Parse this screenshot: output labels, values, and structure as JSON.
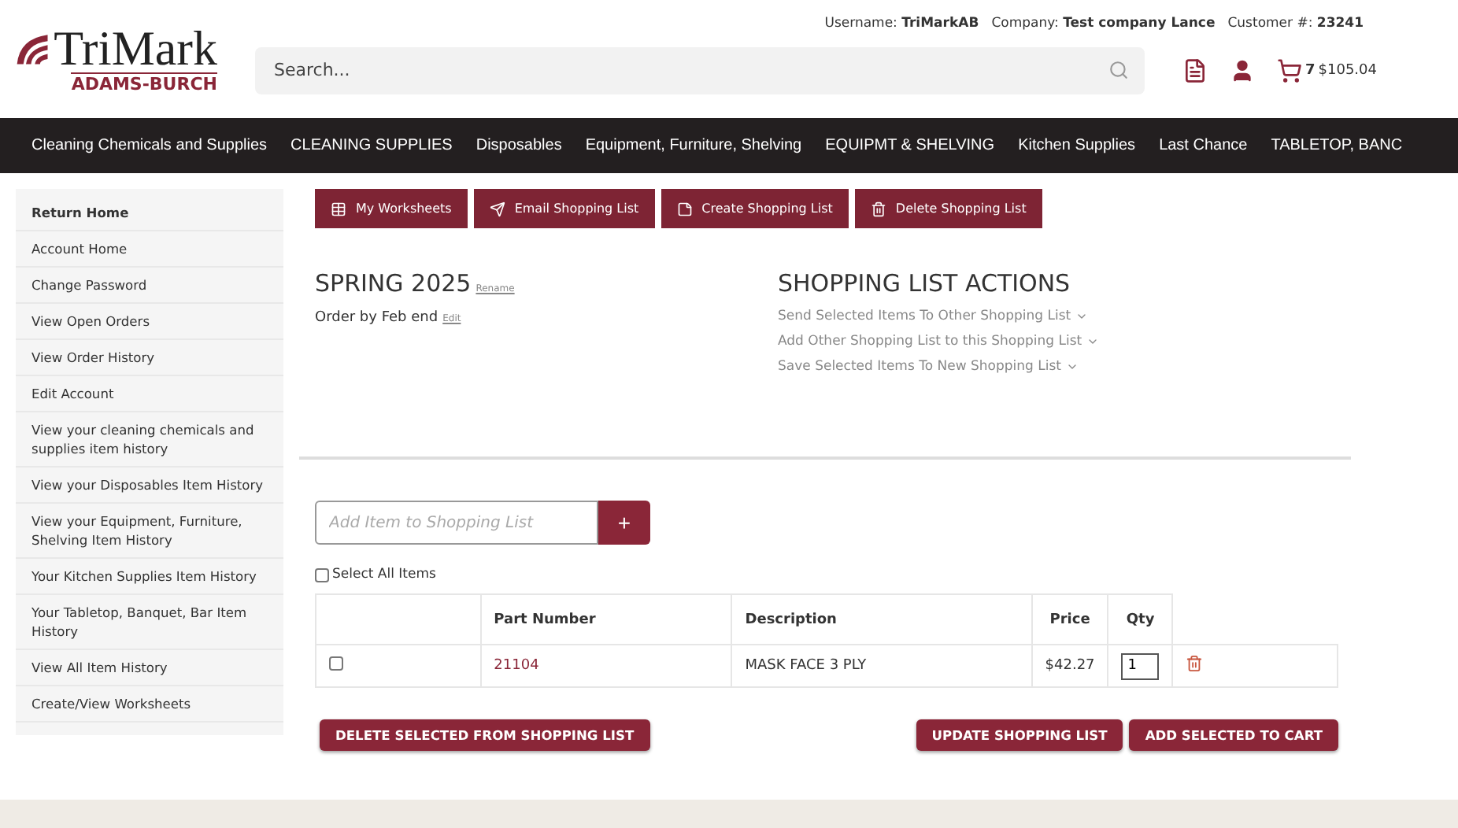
{
  "header": {
    "logo": {
      "name": "TriMark",
      "subtitle": "ADAMS-BURCH"
    },
    "search": {
      "placeholder": "Search..."
    },
    "account": [
      {
        "label": "Username:",
        "value": "TriMarkAB"
      },
      {
        "label": "Company:",
        "value": "Test company Lance"
      },
      {
        "label": "Customer #:",
        "value": "23241"
      }
    ],
    "cart": {
      "count": "7",
      "total": "$105.04"
    }
  },
  "nav": [
    "Cleaning Chemicals and Supplies",
    "CLEANING SUPPLIES",
    "Disposables",
    "Equipment, Furniture, Shelving",
    "EQUIPMT & SHELVING",
    "Kitchen Supplies",
    "Last Chance",
    "TABLETOP, BANC"
  ],
  "sidebar": {
    "items": [
      {
        "label": "Return Home",
        "kind": "heading"
      },
      {
        "label": "Account Home",
        "kind": "link"
      },
      {
        "label": "Change Password",
        "kind": "link"
      },
      {
        "label": "View Open Orders",
        "kind": "link"
      },
      {
        "label": "View Order History",
        "kind": "link"
      },
      {
        "label": "Edit Account",
        "kind": "link"
      },
      {
        "label": "View your cleaning chemicals and supplies item history",
        "kind": "link"
      },
      {
        "label": "View your Disposables Item History",
        "kind": "link"
      },
      {
        "label": "View your Equipment, Furniture, Shelving Item History",
        "kind": "link"
      },
      {
        "label": "Your Kitchen Supplies Item History",
        "kind": "link"
      },
      {
        "label": "Your Tabletop, Banquet, Bar Item History",
        "kind": "link"
      },
      {
        "label": "View All Item History",
        "kind": "link"
      },
      {
        "label": "Create/View Worksheets",
        "kind": "link"
      }
    ]
  },
  "toolbar": [
    {
      "label": "My Worksheets",
      "kind": "worksheets"
    },
    {
      "label": "Email Shopping List",
      "kind": "email"
    },
    {
      "label": "Create Shopping List",
      "kind": "create"
    },
    {
      "label": "Delete Shopping List",
      "kind": "delete"
    }
  ],
  "list": {
    "title": "SPRING 2025",
    "rename": "Rename",
    "note": "Order by Feb end",
    "edit": "Edit"
  },
  "actions": {
    "title": "SHOPPING LIST ACTIONS",
    "items": [
      "Send Selected Items To Other Shopping List",
      "Add Other Shopping List to this Shopping List",
      "Save Selected Items To New Shopping List"
    ]
  },
  "add_item": {
    "placeholder": "Add Item to Shopping List",
    "button": "+"
  },
  "select_all": {
    "label": "Select All Items",
    "checked": false
  },
  "table": {
    "columns": [
      "Part Number",
      "Description",
      "Price",
      "Qty"
    ],
    "rows": [
      {
        "checked": false,
        "part": "21104",
        "description": "MASK FACE 3 PLY",
        "price": "$42.27",
        "qty": "1"
      }
    ]
  },
  "buttons": {
    "left": "DELETE SELECTED FROM SHOPPING LIST",
    "right": [
      "UPDATE SHOPPING LIST",
      "ADD SELECTED TO CART"
    ]
  }
}
